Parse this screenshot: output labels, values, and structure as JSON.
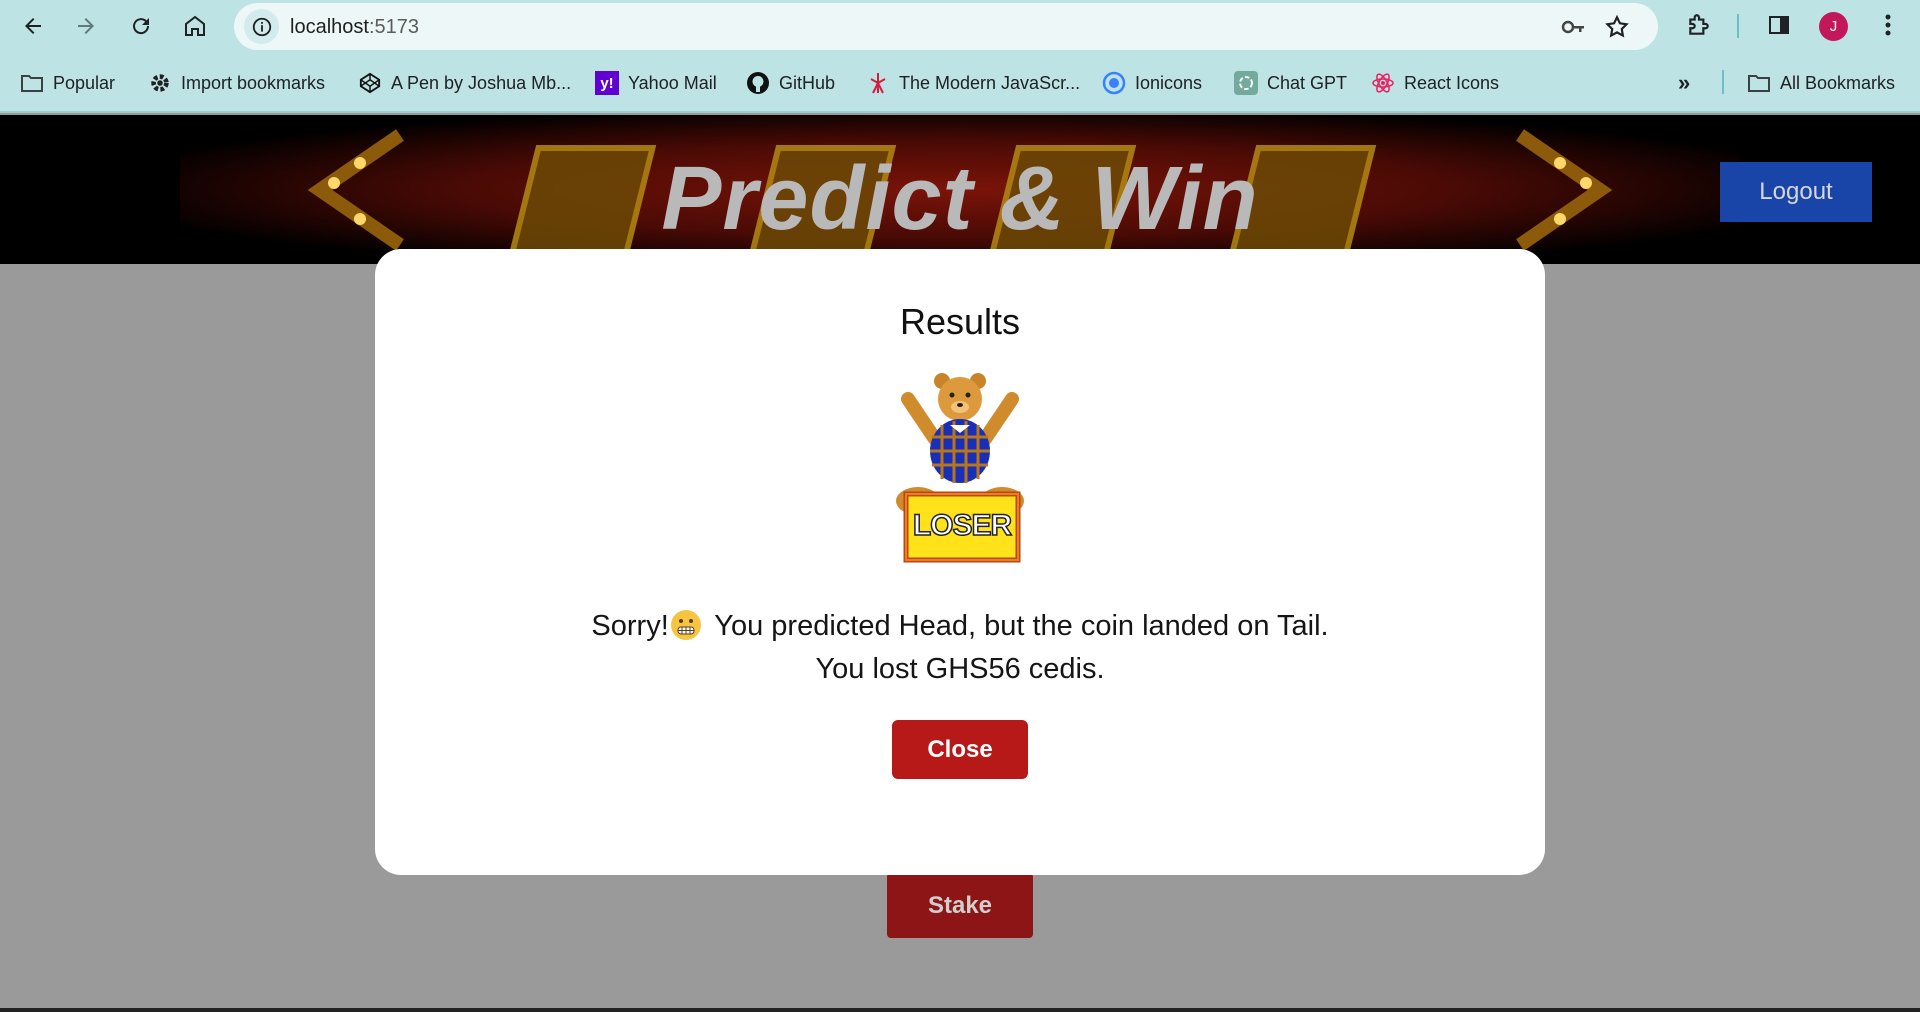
{
  "browser": {
    "url_host": "localhost",
    "url_port": ":5173",
    "avatar_letter": "J",
    "bookmarks": [
      {
        "label": "Popular",
        "icon": "folder-icon"
      },
      {
        "label": "Import bookmarks",
        "icon": "gear-icon"
      },
      {
        "label": "A Pen by Joshua Mb...",
        "icon": "codepen-icon"
      },
      {
        "label": "Yahoo Mail",
        "icon": "yahoo-icon"
      },
      {
        "label": "GitHub",
        "icon": "github-icon"
      },
      {
        "label": "The Modern JavaScr...",
        "icon": "javascript-info-icon"
      },
      {
        "label": "Ionicons",
        "icon": "ionicons-icon"
      },
      {
        "label": "Chat GPT",
        "icon": "chatgpt-icon"
      },
      {
        "label": "React Icons",
        "icon": "react-icon"
      }
    ],
    "all_bookmarks_label": "All Bookmarks"
  },
  "page": {
    "hero_title": "Predict & Win",
    "logout_label": "Logout",
    "stake_label": "Stake"
  },
  "modal": {
    "title": "Results",
    "sign_text": "LOSER",
    "line1_prefix": "Sorry!",
    "line1_suffix": " You predicted Head, but the coin landed on Tail.",
    "line2": "You lost GHS56 cedis.",
    "close_label": "Close"
  },
  "colors": {
    "chrome_bg": "#bde3e4",
    "overlay": "#9a9a9a",
    "logout_bg": "#1945a8",
    "close_bg": "#b71818",
    "stake_bg": "#8d1515"
  }
}
